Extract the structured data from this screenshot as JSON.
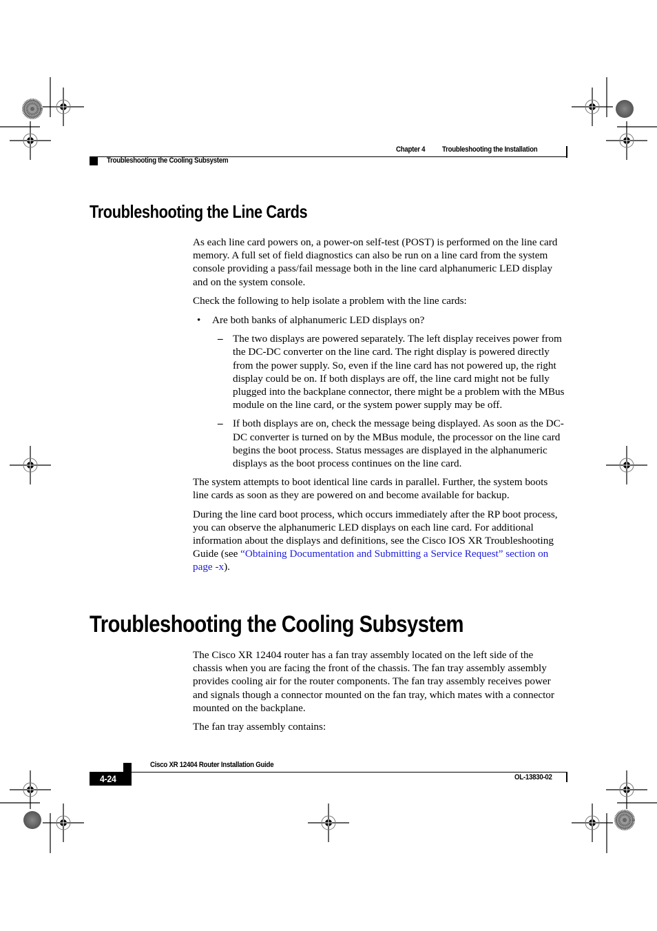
{
  "header": {
    "chapter_label": "Chapter 4",
    "chapter_title": "Troubleshooting the Installation",
    "section_title": "Troubleshooting the Cooling Subsystem"
  },
  "sections": [
    {
      "heading": "Troubleshooting the Line Cards",
      "intro": "As each line card powers on, a power-on self-test (POST) is performed on the line card memory. A full set of field diagnostics can also be run on a line card from the system console providing a pass/fail message both in the line card alphanumeric LED display and on the system console.",
      "check_intro": "Check the following to help isolate a problem with the line cards:",
      "bullets": [
        {
          "marker": "•",
          "text": "Are both banks of alphanumeric LED displays on?",
          "subitems": [
            {
              "marker": "–",
              "text": "The two displays are powered separately. The left display receives power from the DC-DC converter on the line card. The right display is powered directly from the power supply. So, even if the line card has not powered up, the right display could be on. If both displays are off, the line card might not be fully plugged into the backplane connector, there might be a problem with the MBus module on the line card, or the system power supply may be off."
            },
            {
              "marker": "–",
              "text": "If both displays are on, check the message being displayed. As soon as the DC-DC converter is turned on by the MBus module, the processor on the line card begins the boot process. Status messages are displayed in the alphanumeric displays as the boot process continues on the line card."
            }
          ]
        }
      ],
      "parallel_boot": "The system attempts to boot identical line cards in parallel. Further, the system boots line cards as soon as they are powered on and become available for backup.",
      "boot_process_before_link": "During the line card boot process, which occurs immediately after the RP boot process, you can observe the alphanumeric LED displays on each line card. For additional information about the displays and definitions, see the Cisco IOS XR Troubleshooting Guide (see ",
      "boot_process_link": "“Obtaining Documentation and Submitting a Service Request” section on page -x",
      "boot_process_after_link": ")."
    },
    {
      "heading": "Troubleshooting the Cooling Subsystem",
      "intro": "The Cisco XR 12404 router has a fan tray assembly located on the left side of the chassis when you are facing the front of the chassis. The fan tray assembly assembly provides cooling air for the router components. The fan tray assembly receives power and signals though a connector mounted on the fan tray, which mates with a connector mounted on the backplane.",
      "contains": "The fan tray assembly contains:"
    }
  ],
  "footer": {
    "guide_title": "Cisco XR 12404 Router Installation Guide",
    "page_number": "4-24",
    "doc_number": "OL-13830-02"
  },
  "colors": {
    "link": "#1a1adb",
    "text": "#000000"
  },
  "print_marks": {
    "registration_marks": "crosshair-target-icon",
    "color_bars": "starburst-calibration-icon"
  }
}
